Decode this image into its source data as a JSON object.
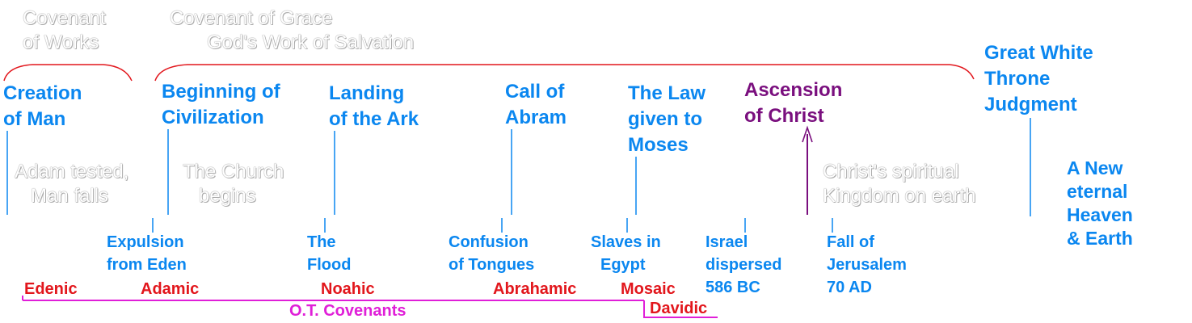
{
  "header": {
    "covenant_works": [
      "Covenant",
      "of Works"
    ],
    "covenant_grace": [
      "Covenant of Grace",
      "God's Work of Salvation"
    ]
  },
  "events_top": {
    "creation": [
      "Creation",
      "of Man"
    ],
    "civilization": [
      "Beginning of",
      "Civilization"
    ],
    "landing": [
      "Landing",
      "of the Ark"
    ],
    "abram": [
      "Call of",
      "Abram"
    ],
    "law": [
      "The Law",
      "given to",
      "Moses"
    ],
    "ascension": [
      "Ascension",
      "of Christ"
    ],
    "throne": [
      "Great White",
      "Throne",
      "Judgment"
    ]
  },
  "ghost_notes": {
    "adam": [
      "Adam tested,",
      "Man falls"
    ],
    "church": [
      "The Church",
      "begins"
    ],
    "kingdom": [
      "Christ's spiritual",
      "Kingdom on earth"
    ]
  },
  "new_heaven": [
    "A New",
    "eternal",
    "Heaven",
    "& Earth"
  ],
  "events_bottom": {
    "expulsion": [
      "Expulsion",
      "from Eden"
    ],
    "flood": [
      "The",
      "Flood"
    ],
    "confusion": [
      "Confusion",
      "of Tongues"
    ],
    "slaves": [
      "Slaves in",
      "Egypt"
    ],
    "israel": [
      "Israel",
      "dispersed",
      "586 BC"
    ],
    "jerusalem": [
      "Fall of",
      "Jerusalem",
      "70 AD"
    ]
  },
  "covenants": {
    "edenic": "Edenic",
    "adamic": "Adamic",
    "noahic": "Noahic",
    "abrahamic": "Abrahamic",
    "mosaic": "Mosaic",
    "davidic": "Davidic",
    "ot_label": "O.T. Covenants"
  },
  "colors": {
    "event_blue": "#0b87f0",
    "ascension_purple": "#7a0f7e",
    "brace_red": "#e2161c",
    "covenant_magenta": "#e01fd8"
  }
}
